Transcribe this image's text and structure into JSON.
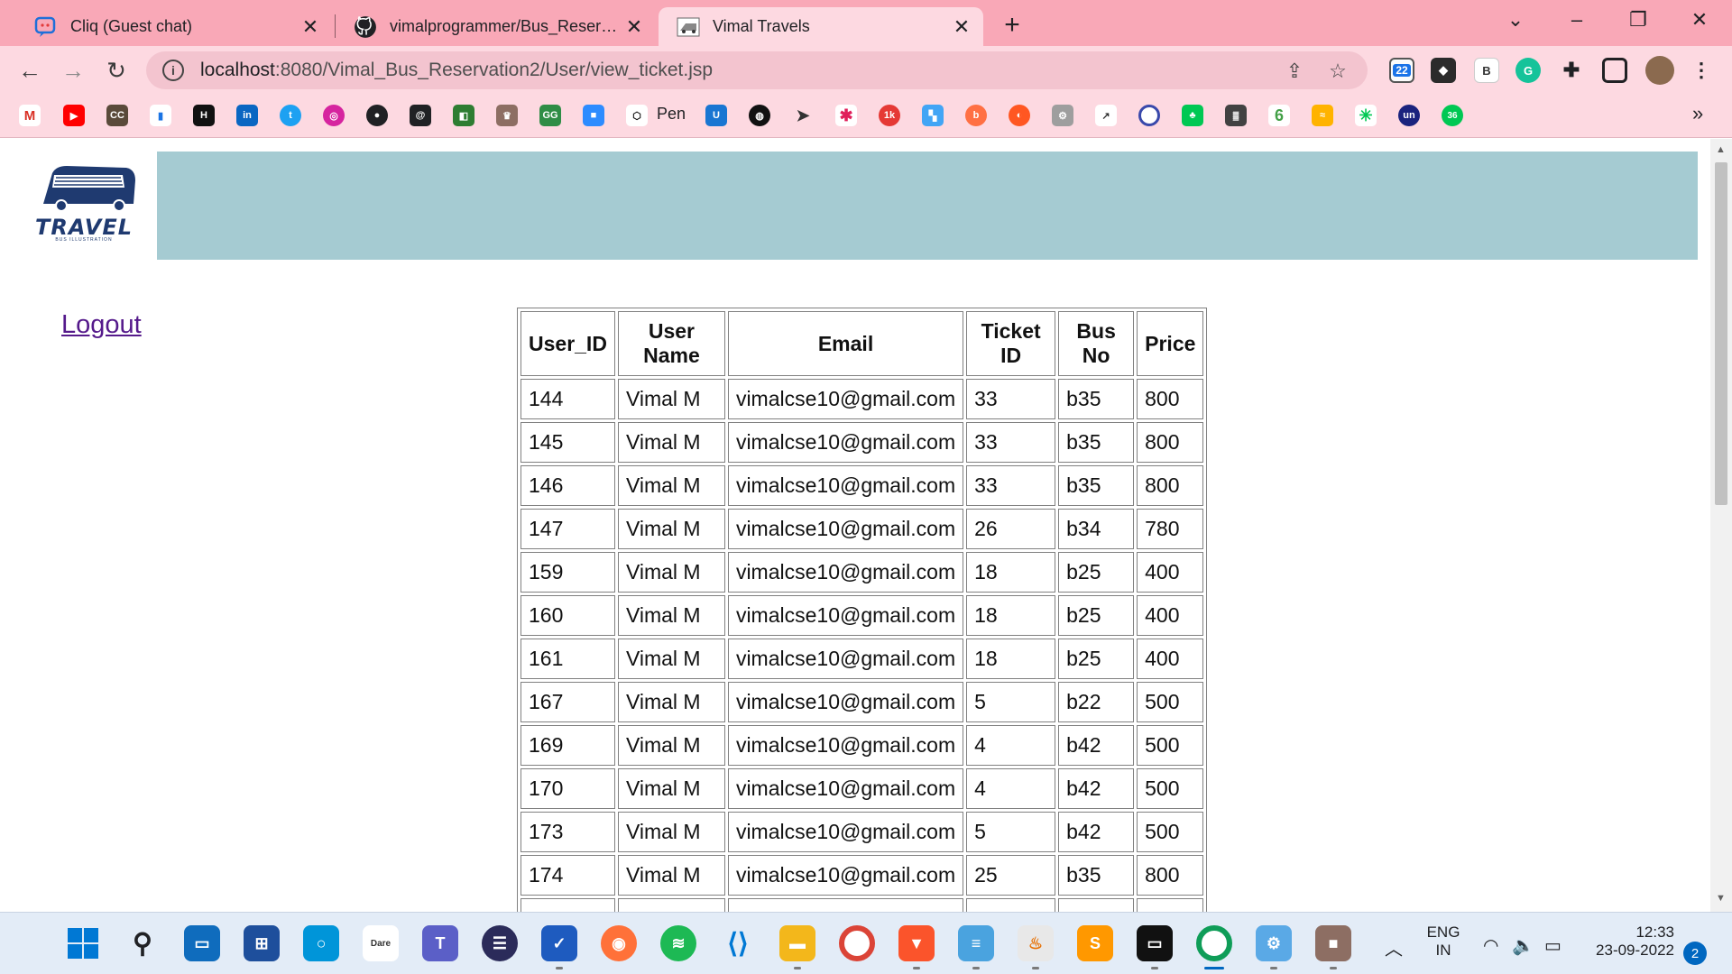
{
  "browser": {
    "tabs": [
      {
        "title": "Cliq (Guest chat)",
        "icon": "cliq-icon"
      },
      {
        "title": "vimalprogrammer/Bus_Reservation",
        "icon": "github-icon"
      },
      {
        "title": "Vimal Travels",
        "icon": "bus-favicon",
        "active": true
      }
    ],
    "url_host": "localhost",
    "url_path": ":8080/Vimal_Bus_Reservation2/User/view_ticket.jsp",
    "extension_badge": "22",
    "bookmarks_pen_label": "Pen"
  },
  "page": {
    "logo_text": "TRAVEL",
    "logo_subtext": "BUS ILLUSTRATION",
    "banner_color": "#a5cbd2",
    "logout_label": "Logout",
    "table": {
      "headers": [
        "User_ID",
        "User Name",
        "Email",
        "Ticket ID",
        "Bus No",
        "Price"
      ],
      "rows": [
        [
          "144",
          "Vimal M",
          "vimalcse10@gmail.com",
          "33",
          "b35",
          "800"
        ],
        [
          "145",
          "Vimal M",
          "vimalcse10@gmail.com",
          "33",
          "b35",
          "800"
        ],
        [
          "146",
          "Vimal M",
          "vimalcse10@gmail.com",
          "33",
          "b35",
          "800"
        ],
        [
          "147",
          "Vimal M",
          "vimalcse10@gmail.com",
          "26",
          "b34",
          "780"
        ],
        [
          "159",
          "Vimal M",
          "vimalcse10@gmail.com",
          "18",
          "b25",
          "400"
        ],
        [
          "160",
          "Vimal M",
          "vimalcse10@gmail.com",
          "18",
          "b25",
          "400"
        ],
        [
          "161",
          "Vimal M",
          "vimalcse10@gmail.com",
          "18",
          "b25",
          "400"
        ],
        [
          "167",
          "Vimal M",
          "vimalcse10@gmail.com",
          "5",
          "b22",
          "500"
        ],
        [
          "169",
          "Vimal M",
          "vimalcse10@gmail.com",
          "4",
          "b42",
          "500"
        ],
        [
          "170",
          "Vimal M",
          "vimalcse10@gmail.com",
          "4",
          "b42",
          "500"
        ],
        [
          "173",
          "Vimal M",
          "vimalcse10@gmail.com",
          "5",
          "b42",
          "500"
        ],
        [
          "174",
          "Vimal M",
          "vimalcse10@gmail.com",
          "25",
          "b35",
          "800"
        ],
        [
          "",
          "",
          "",
          "",
          "",
          ""
        ]
      ]
    }
  },
  "taskbar": {
    "lang_line1": "ENG",
    "lang_line2": "IN",
    "time": "12:33",
    "date": "23-09-2022",
    "notification_count": "2"
  }
}
